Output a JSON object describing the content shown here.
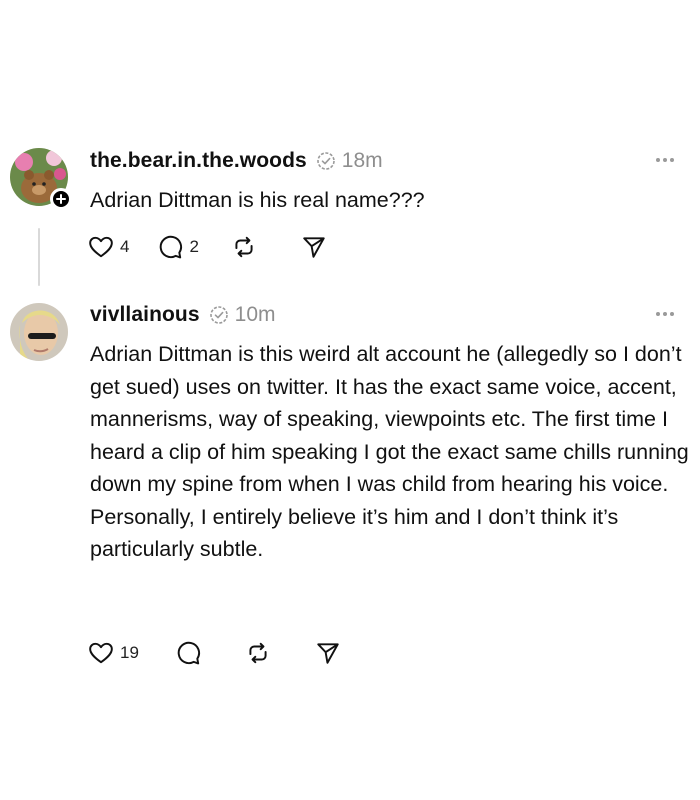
{
  "posts": [
    {
      "username": "the.bear.in.the.woods",
      "timestamp": "18m",
      "text": "Adrian Dittman is his real name???",
      "likes": "4",
      "replies": "2",
      "avatar_icon": "bear-avatar",
      "follow_icon": "plus-icon"
    },
    {
      "username": "vivllainous",
      "timestamp": "10m",
      "text": "Adrian Dittman is this weird alt account he (allegedly so I don’t get sued) uses on twitter. It has the exact same voice, accent, mannerisms, way of speaking, viewpoints etc. The first time I heard a clip of him speaking I got the exact same chills running down my spine from when I was child from hearing his voice. Personally, I entirely believe it’s him and I don’t think it’s particularly subtle.",
      "likes": "19",
      "avatar_icon": "person-avatar"
    }
  ],
  "icons": {
    "like": "heart-icon",
    "reply": "comment-icon",
    "repost": "repost-icon",
    "share": "send-icon",
    "more": "more-icon",
    "verified": "verified-icon"
  },
  "colors": {
    "text": "#111111",
    "muted": "#8e8e8e",
    "thread_line": "#d9d9d9"
  }
}
